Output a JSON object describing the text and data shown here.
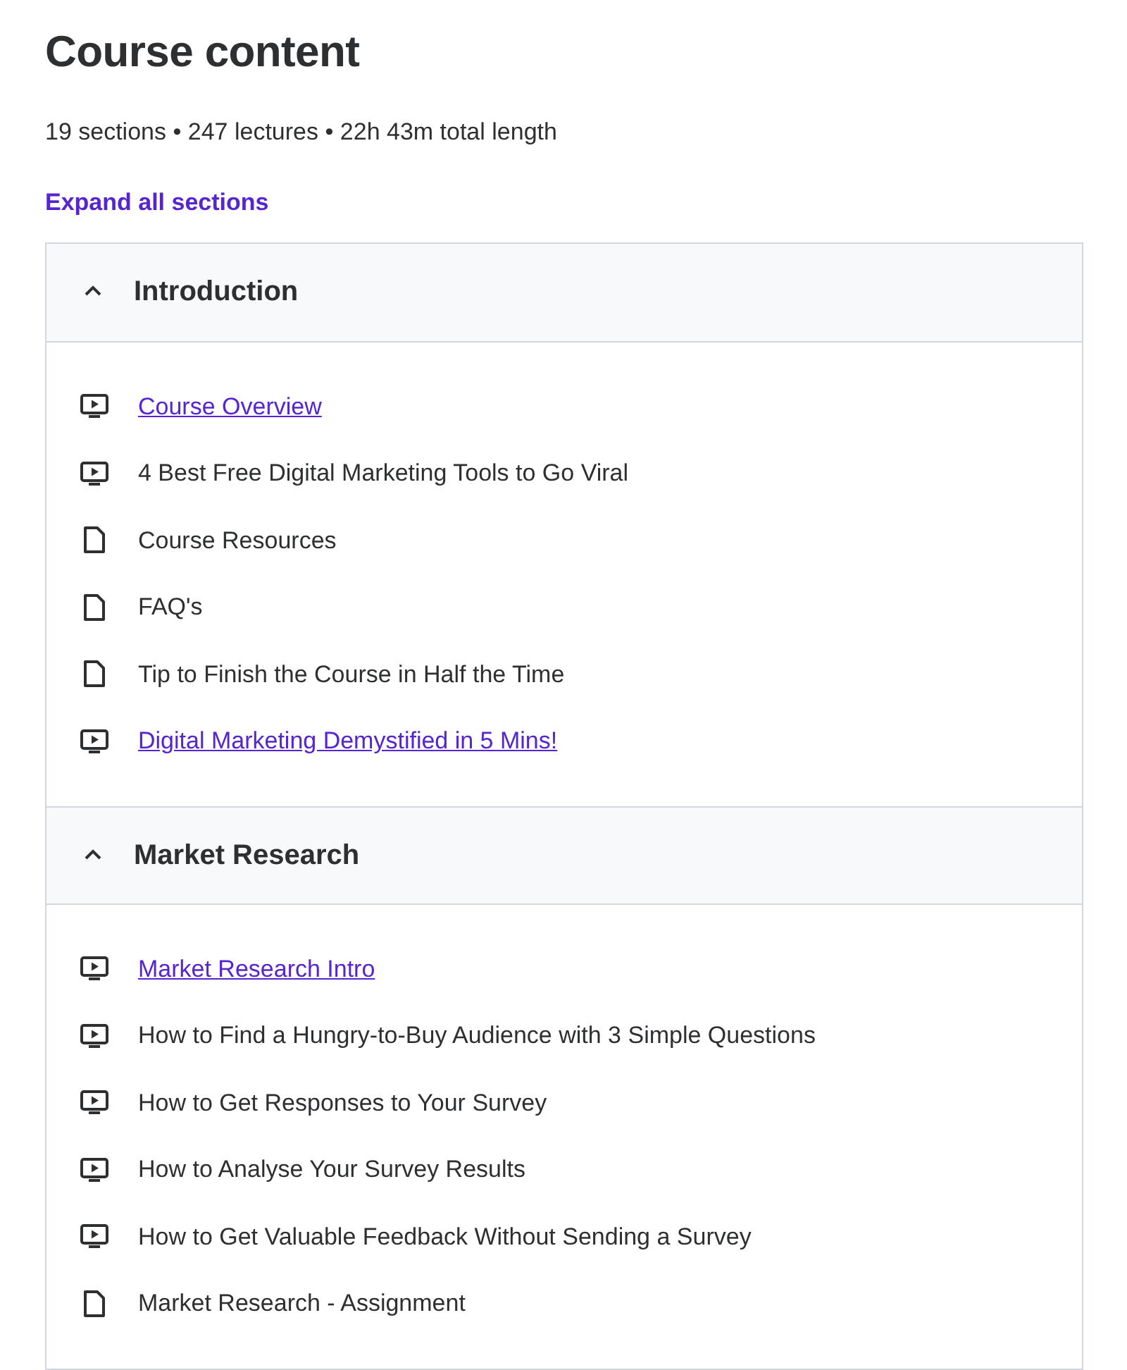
{
  "title": "Course content",
  "summary": "19 sections • 247 lectures • 22h 43m total length",
  "expand_all": "Expand all sections",
  "sections": [
    {
      "title": "Introduction",
      "expanded": true,
      "lectures": [
        {
          "kind": "video",
          "title": "Course Overview",
          "preview": true
        },
        {
          "kind": "video",
          "title": "4 Best Free Digital Marketing Tools to Go Viral",
          "preview": false
        },
        {
          "kind": "article",
          "title": "Course Resources",
          "preview": false
        },
        {
          "kind": "article",
          "title": "FAQ's",
          "preview": false
        },
        {
          "kind": "article",
          "title": "Tip to Finish the Course in Half the Time",
          "preview": false
        },
        {
          "kind": "video",
          "title": "Digital Marketing Demystified in 5 Mins!",
          "preview": true
        }
      ]
    },
    {
      "title": "Market Research",
      "expanded": true,
      "lectures": [
        {
          "kind": "video",
          "title": "Market Research Intro",
          "preview": true
        },
        {
          "kind": "video",
          "title": "How to Find a Hungry-to-Buy Audience with 3 Simple Questions",
          "preview": false
        },
        {
          "kind": "video",
          "title": "How to Get Responses to Your Survey",
          "preview": false
        },
        {
          "kind": "video",
          "title": "How to Analyse Your Survey Results",
          "preview": false
        },
        {
          "kind": "video",
          "title": "How to Get Valuable Feedback Without Sending a Survey",
          "preview": false
        },
        {
          "kind": "article",
          "title": "Market Research - Assignment",
          "preview": false
        }
      ]
    }
  ]
}
